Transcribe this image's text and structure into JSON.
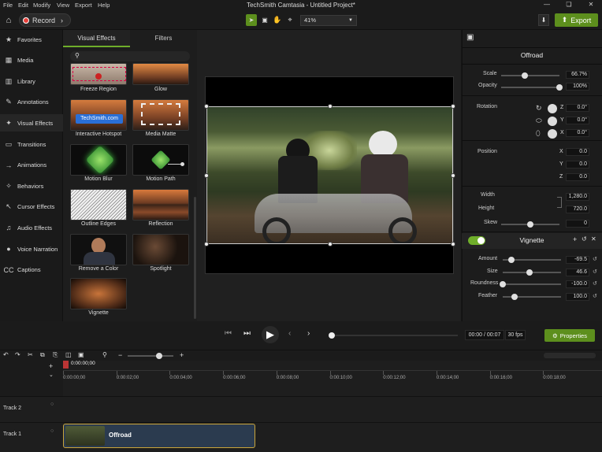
{
  "menu": {
    "items": [
      "File",
      "Edit",
      "Modify",
      "View",
      "Export",
      "Help"
    ],
    "title": "TechSmith Camtasia - Untitled Project*"
  },
  "toolbar": {
    "record_label": "Record",
    "zoom_value": "41%",
    "export_label": "Export"
  },
  "nav": {
    "items": [
      {
        "label": "Favorites",
        "icon": "star-icon"
      },
      {
        "label": "Media",
        "icon": "film-icon"
      },
      {
        "label": "Library",
        "icon": "library-icon"
      },
      {
        "label": "Annotations",
        "icon": "annotation-icon"
      },
      {
        "label": "Visual Effects",
        "icon": "magic-wand-icon"
      },
      {
        "label": "Transitions",
        "icon": "transition-icon"
      },
      {
        "label": "Animations",
        "icon": "animation-icon"
      },
      {
        "label": "Behaviors",
        "icon": "behavior-icon"
      },
      {
        "label": "Cursor Effects",
        "icon": "cursor-icon"
      },
      {
        "label": "Audio Effects",
        "icon": "audio-icon"
      },
      {
        "label": "Voice Narration",
        "icon": "microphone-icon"
      },
      {
        "label": "Captions",
        "icon": "cc-icon"
      }
    ]
  },
  "effects": {
    "tabs": [
      "Visual Effects",
      "Filters"
    ],
    "tiles": [
      "Freeze Region",
      "Glow",
      "Interactive Hotspot",
      "Media Matte",
      "Motion Blur",
      "Motion Path",
      "Outline Edges",
      "Reflection",
      "Remove a Color",
      "Spotlight",
      "Vignette"
    ],
    "hotspot_text": "TechSmith.com"
  },
  "properties": {
    "title": "Offroad",
    "scale_label": "Scale",
    "scale_value": "66.7%",
    "scale_level": 0.4,
    "opacity_label": "Opacity",
    "opacity_value": "100%",
    "opacity_level": 1.0,
    "rotation_label": "Rotation",
    "rotation": [
      {
        "axis": "Z",
        "value": "0.0°"
      },
      {
        "axis": "Y",
        "value": "0.0°"
      },
      {
        "axis": "X",
        "value": "0.0°"
      }
    ],
    "position_label": "Position",
    "position": [
      {
        "axis": "X",
        "value": "0.0"
      },
      {
        "axis": "Y",
        "value": "0.0"
      },
      {
        "axis": "Z",
        "value": "0.0"
      }
    ],
    "width_label": "Width",
    "width_value": "1,280.0",
    "height_label": "Height",
    "height_value": "720.0",
    "skew_label": "Skew",
    "skew_value": "0",
    "skew_level": 0.5,
    "vignette_title": "Vignette",
    "vignette": [
      {
        "label": "Amount",
        "value": "-69.5",
        "level": 0.15
      },
      {
        "label": "Size",
        "value": "46.6",
        "level": 0.46
      },
      {
        "label": "Roundness",
        "value": "-100.0",
        "level": 0.0
      },
      {
        "label": "Feather",
        "value": "100.0",
        "level": 0.2
      }
    ]
  },
  "playback": {
    "time": "00:00 / 00:07",
    "fps": "30 fps",
    "properties_label": "Properties"
  },
  "timeline": {
    "playhead": "0:00:00;00",
    "ruler": [
      "0:00:00;00",
      "0:00:02;00",
      "0:00:04;00",
      "0:00:06;00",
      "0:00:08;00",
      "0:00:10;00",
      "0:00:12;00",
      "0:00:14;00",
      "0:00:16;00",
      "0:00:18;00"
    ],
    "tracks": [
      {
        "label": "Track 2"
      },
      {
        "label": "Track 1",
        "clip": "Offroad"
      }
    ]
  }
}
